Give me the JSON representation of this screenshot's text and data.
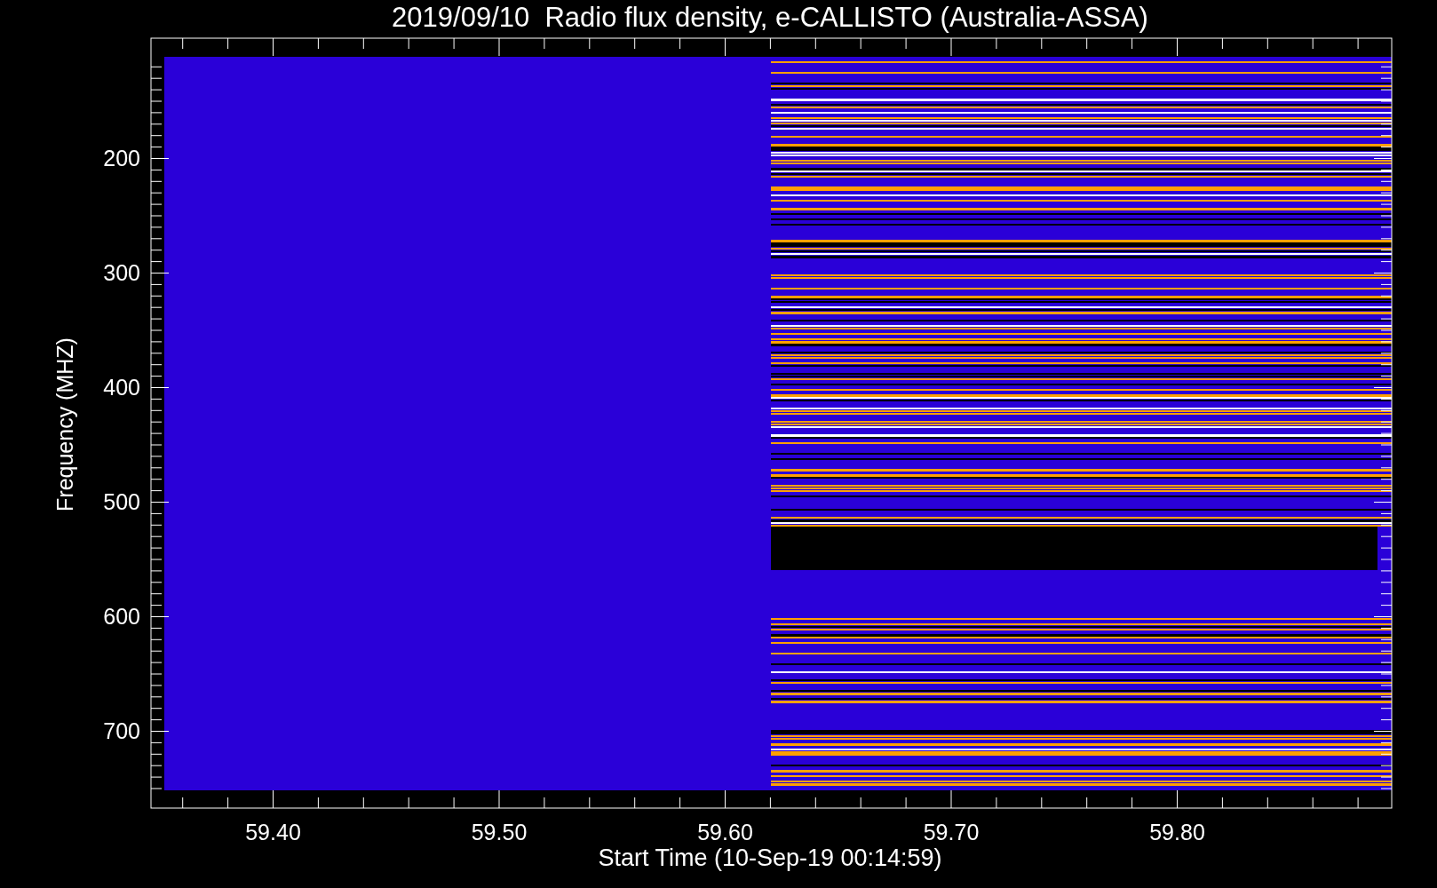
{
  "title": "2019/09/10  Radio flux density, e-CALLISTO (Australia-ASSA)",
  "y_axis": {
    "label": "Frequency (MHZ)",
    "ticks": [
      "200",
      "300",
      "400",
      "500",
      "600",
      "700"
    ]
  },
  "x_axis": {
    "label": "Start Time (10-Sep-19 00:14:59)",
    "ticks": [
      "59.40",
      "59.50",
      "59.60",
      "59.70",
      "59.80"
    ]
  }
}
